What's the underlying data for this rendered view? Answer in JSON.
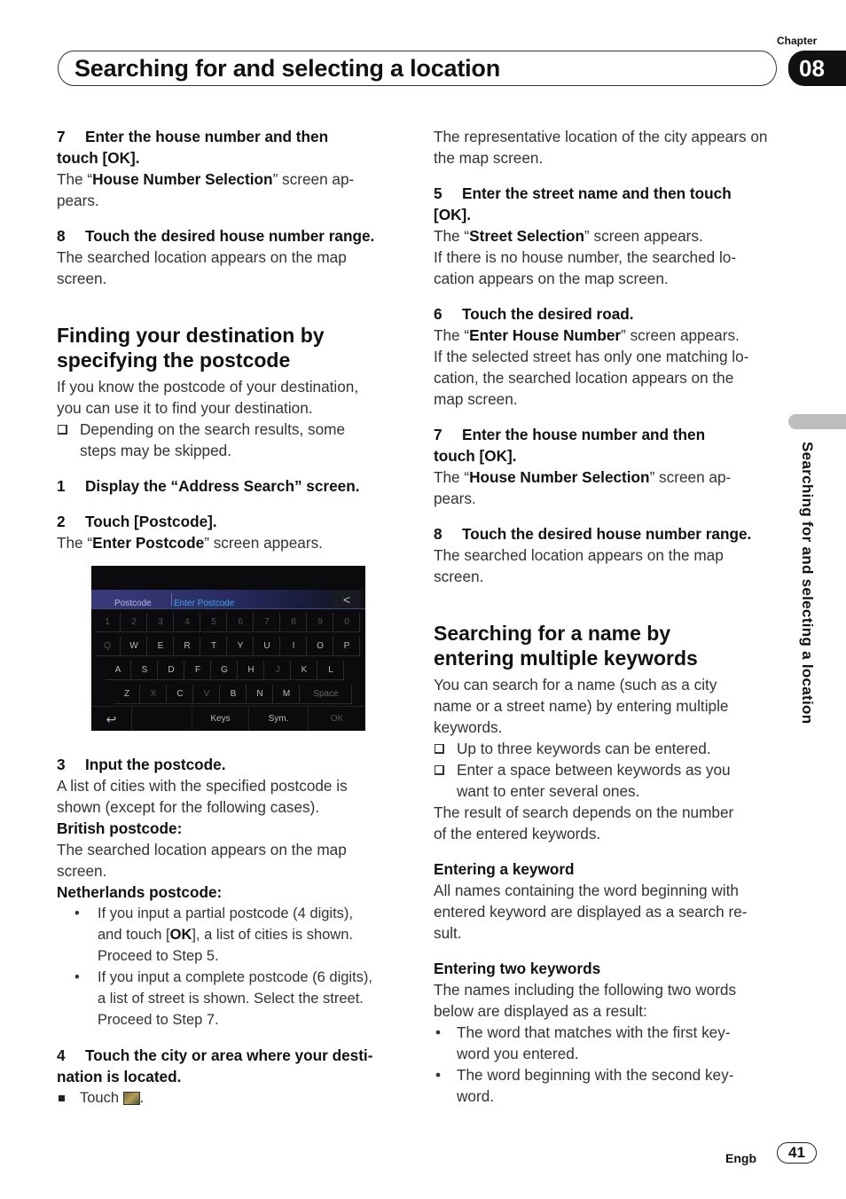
{
  "header": {
    "chapter_label": "Chapter",
    "chapter_number": "08",
    "title": "Searching for and selecting a location"
  },
  "left_column": {
    "step7": {
      "num": "7",
      "title_a": "Enter the house number and then",
      "title_b": "touch [OK]."
    },
    "step7_text_pre": "The “",
    "step7_text_bold": "House Number Selection",
    "step7_text_post_a": "” screen ap-",
    "step7_text_post_b": "pears.",
    "step8": {
      "num": "8",
      "title": "Touch the desired house number range."
    },
    "step8_text_a": "The searched location appears on the map",
    "step8_text_b": "screen.",
    "section_title_a": "Finding your destination by",
    "section_title_b": "specifying the postcode",
    "intro_a": "If you know the postcode of your destination,",
    "intro_b": "you can use it to find your destination.",
    "note_a": "Depending on the search results, some",
    "note_b": "steps may be skipped.",
    "step1": {
      "num": "1",
      "title": "Display the “Address Search” screen."
    },
    "step2": {
      "num": "2",
      "title": "Touch [Postcode]."
    },
    "step2_text_pre": "The “",
    "step2_text_bold": "Enter Postcode",
    "step2_text_post": "” screen appears.",
    "keyboard_screen": {
      "title_left": "Postcode",
      "title_right": "Enter Postcode",
      "back_label": "<",
      "row_numbers": [
        "1",
        "2",
        "3",
        "4",
        "5",
        "6",
        "7",
        "8",
        "9",
        "0"
      ],
      "row_q": [
        "Q",
        "W",
        "E",
        "R",
        "T",
        "Y",
        "U",
        "I",
        "O",
        "P"
      ],
      "row_a": [
        "A",
        "S",
        "D",
        "F",
        "G",
        "H",
        "J",
        "K",
        "L"
      ],
      "row_z": [
        "Z",
        "X",
        "C",
        "V",
        "B",
        "N",
        "M"
      ],
      "space_label": "Space",
      "return_icon": "↩",
      "keys_label": "Keys",
      "sym_label": "Sym.",
      "ok_label": "OK"
    },
    "step3": {
      "num": "3",
      "title": "Input the postcode."
    },
    "step3_text_a": "A list of cities with the specified postcode is",
    "step3_text_b": "shown (except for the following cases).",
    "british_heading": "British postcode:",
    "british_text_a": "The searched location appears on the map",
    "british_text_b": "screen.",
    "netherlands_heading": "Netherlands postcode:",
    "nl_bullet1_a": "If you input a partial postcode (4 digits),",
    "nl_bullet1_b_pre": "and touch [",
    "nl_bullet1_b_bold": "OK",
    "nl_bullet1_b_post": "], a list of cities is shown.",
    "nl_bullet1_c": "Proceed to Step 5.",
    "nl_bullet2_a": "If you input a complete postcode (6 digits),",
    "nl_bullet2_b": "a list of street is shown. Select the street.",
    "nl_bullet2_c": "Proceed to Step 7.",
    "step4": {
      "num": "4",
      "title_a": "Touch the city or area where your desti-",
      "title_b": "nation is located."
    },
    "step4_touch": "Touch",
    "step4_touch_end": "."
  },
  "right_column": {
    "top_text_a": "The representative location of the city appears on",
    "top_text_b": "the map screen.",
    "step5": {
      "num": "5",
      "title_a": "Enter the street name and then touch",
      "title_b": "[OK]."
    },
    "step5_text_pre": "The “",
    "step5_text_bold": "Street Selection",
    "step5_text_post": "” screen appears.",
    "step5_text2_a": "If there is no house number, the searched lo-",
    "step5_text2_b": "cation appears on the map screen.",
    "step6": {
      "num": "6",
      "title": "Touch the desired road."
    },
    "step6_text_pre": "The “",
    "step6_text_bold": "Enter House Number",
    "step6_text_post": "” screen appears.",
    "step6_text2_a": "If the selected street has only one matching lo-",
    "step6_text2_b": "cation, the searched location appears on the",
    "step6_text2_c": "map screen.",
    "step7": {
      "num": "7",
      "title_a": "Enter the house number and then",
      "title_b": "touch [OK]."
    },
    "step7_text_pre": "The “",
    "step7_text_bold": "House Number Selection",
    "step7_text_post_a": "” screen ap-",
    "step7_text_post_b": "pears.",
    "step8": {
      "num": "8",
      "title": "Touch the desired house number range."
    },
    "step8_text_a": "The searched location appears on the map",
    "step8_text_b": "screen.",
    "section_title_a": "Searching for a name by",
    "section_title_b": "entering multiple keywords",
    "intro_a": "You can search for a name (such as a city",
    "intro_b": "name or a street name) by entering multiple",
    "intro_c": "keywords.",
    "note1": "Up to three keywords can be entered.",
    "note2_a": "Enter a space between keywords as you",
    "note2_b": "want to enter several ones.",
    "result_a": "The result of search depends on the number",
    "result_b": "of the entered keywords.",
    "sub1_heading": "Entering a keyword",
    "sub1_text_a": "All names containing the word beginning with",
    "sub1_text_b": "entered keyword are displayed as a search re-",
    "sub1_text_c": "sult.",
    "sub2_heading": "Entering two keywords",
    "sub2_text_a": "The names including the following two words",
    "sub2_text_b": "below are displayed as a result:",
    "sub2_bullet1_a": "The word that matches with the first key-",
    "sub2_bullet1_b": "word you entered.",
    "sub2_bullet2_a": "The word beginning with the second key-",
    "sub2_bullet2_b": "word."
  },
  "side_tab": {
    "text": "Searching for and selecting a location"
  },
  "footer": {
    "language": "Engb",
    "page_number": "41"
  }
}
